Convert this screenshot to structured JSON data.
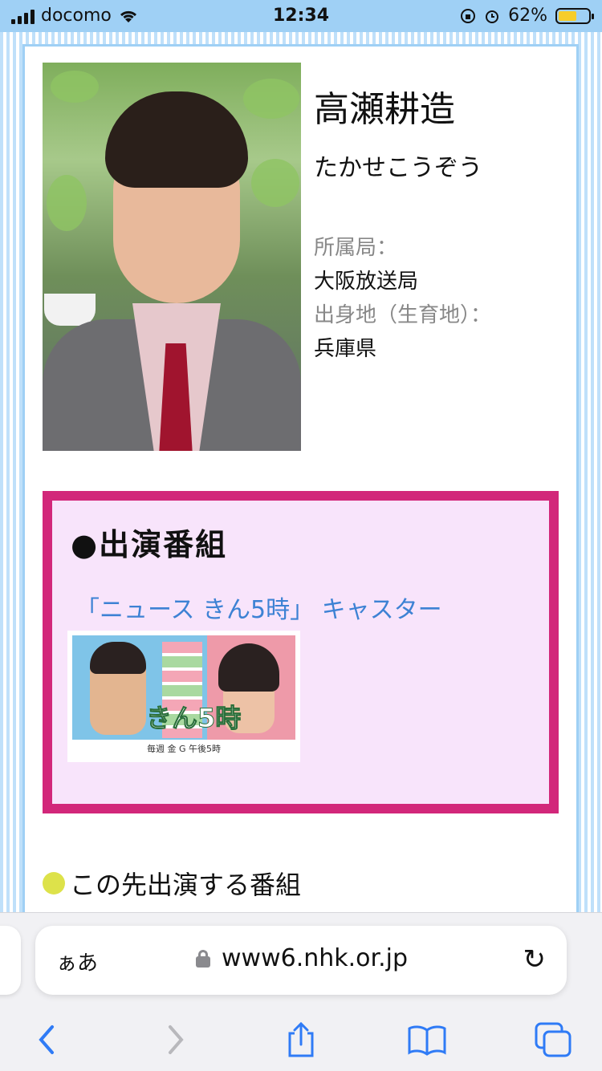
{
  "status_bar": {
    "carrier": "docomo",
    "time": "12:34",
    "battery_percent": "62%",
    "battery_level": 0.62,
    "icons": [
      "signal-icon",
      "wifi-icon",
      "orientation-lock-icon",
      "alarm-icon",
      "battery-icon"
    ]
  },
  "profile": {
    "name": "高瀬耕造",
    "kana": "たかせこうぞう",
    "station_label": "所属局：",
    "station_value": "大阪放送局",
    "hometown_label": "出身地（生育地）：",
    "hometown_value": "兵庫県"
  },
  "programs": {
    "heading": "●出演番組",
    "link_text": "「ニュース きん5時」 キャスター",
    "thumbnail": {
      "logo": "きん5時",
      "footer": "毎週 金 G 午後5時"
    }
  },
  "upcoming": {
    "heading": "この先出演する番組"
  },
  "browser": {
    "aa_label": "ぁあ",
    "url": "www6.nhk.or.jp",
    "toolbar_icons": [
      "back-icon",
      "forward-icon",
      "share-icon",
      "bookmarks-icon",
      "tabs-icon"
    ]
  },
  "colors": {
    "accent_border": "#d2277a",
    "box_background": "#f8e4fb",
    "link": "#3d82d4",
    "status_bar": "#9fd0f5",
    "upcoming_dot": "#dde24a"
  }
}
